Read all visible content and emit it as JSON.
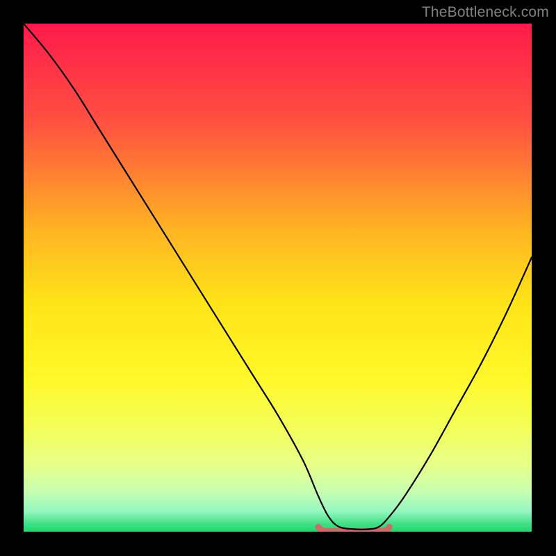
{
  "watermark": "TheBottleneck.com",
  "chart_data": {
    "type": "line",
    "title": "",
    "xlabel": "",
    "ylabel": "",
    "xlim": [
      0,
      100
    ],
    "ylim": [
      0,
      100
    ],
    "x": [
      0,
      5,
      10,
      15,
      20,
      25,
      30,
      35,
      40,
      45,
      50,
      55,
      58,
      60,
      62,
      65,
      68,
      70,
      72,
      75,
      80,
      85,
      90,
      95,
      100
    ],
    "values": [
      100,
      94,
      87,
      79,
      71,
      63,
      55,
      47,
      39,
      31,
      23,
      14,
      7,
      3,
      1,
      0.5,
      0.5,
      1,
      3,
      7,
      15,
      24,
      33,
      43,
      54
    ],
    "background_gradient": {
      "stops": [
        {
          "offset": 0.0,
          "color": "#ff1a4b"
        },
        {
          "offset": 0.2,
          "color": "#ff5340"
        },
        {
          "offset": 0.4,
          "color": "#ffb224"
        },
        {
          "offset": 0.55,
          "color": "#ffe418"
        },
        {
          "offset": 0.7,
          "color": "#fff82a"
        },
        {
          "offset": 0.8,
          "color": "#f3ff5c"
        },
        {
          "offset": 0.87,
          "color": "#e6ff8a"
        },
        {
          "offset": 0.92,
          "color": "#c8ffb0"
        },
        {
          "offset": 0.96,
          "color": "#95f7c0"
        },
        {
          "offset": 0.985,
          "color": "#3fe084"
        },
        {
          "offset": 1.0,
          "color": "#20d66f"
        }
      ]
    },
    "valley_marker": {
      "x_start": 58,
      "x_end": 72,
      "y": 0.5,
      "color": "#cf6a68"
    },
    "curve_color": "#000000",
    "curve_width": 2.2
  }
}
